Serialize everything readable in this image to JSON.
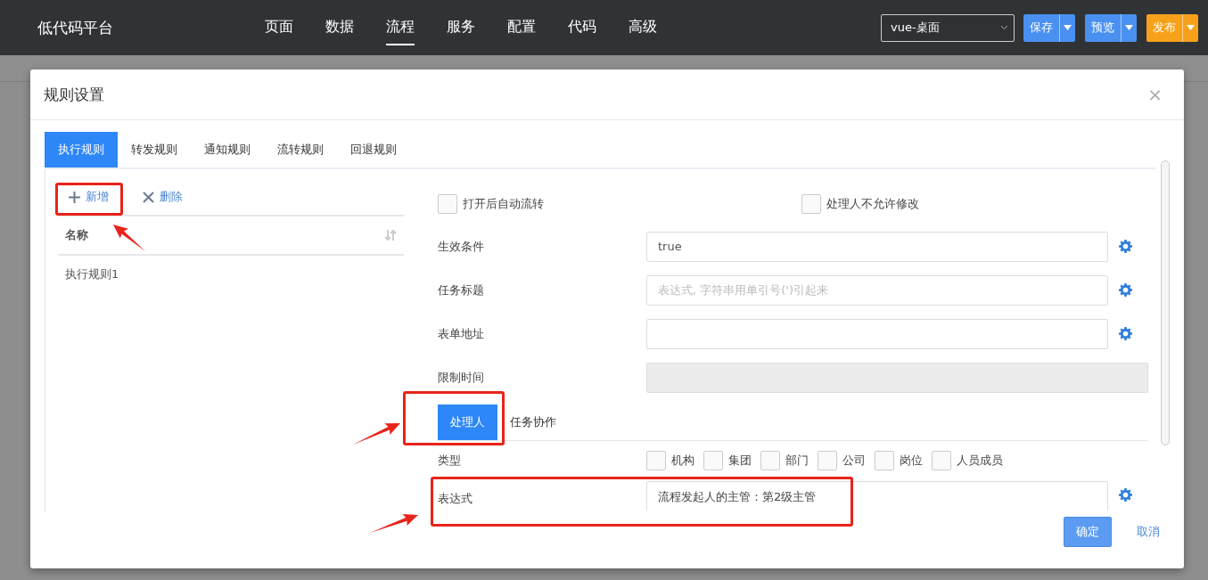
{
  "app": {
    "title": "低代码平台"
  },
  "nav": [
    {
      "label": "页面",
      "selected": false
    },
    {
      "label": "数据",
      "selected": false
    },
    {
      "label": "流程",
      "selected": true
    },
    {
      "label": "服务",
      "selected": false
    },
    {
      "label": "配置",
      "selected": false
    },
    {
      "label": "代码",
      "selected": false
    },
    {
      "label": "高级",
      "selected": false
    }
  ],
  "env_select": {
    "value": "vue-桌面"
  },
  "actions": [
    {
      "label": "保存",
      "kind": "primary"
    },
    {
      "label": "预览",
      "kind": "primary"
    },
    {
      "label": "发布",
      "kind": "warning"
    }
  ],
  "dialog": {
    "title": "规则设置",
    "close": "×",
    "tabs": [
      {
        "label": "执行规则",
        "selected": true
      },
      {
        "label": "转发规则",
        "selected": false
      },
      {
        "label": "通知规则",
        "selected": false
      },
      {
        "label": "流转规则",
        "selected": false
      },
      {
        "label": "回退规则",
        "selected": false
      }
    ],
    "rule_toolbar": [
      {
        "label": "新增",
        "kind": "add"
      },
      {
        "label": "删除",
        "kind": "delete"
      }
    ],
    "rule_table": {
      "columns": [
        "名称"
      ],
      "rows": [
        "执行规则1"
      ]
    },
    "options": [
      {
        "label": "打开后自动流转",
        "checked": false
      },
      {
        "label": "处理人不允许修改",
        "checked": false
      }
    ],
    "fields": [
      {
        "label": "生效条件",
        "kind": "input",
        "value": "true"
      },
      {
        "label": "任务标题",
        "kind": "input",
        "placeholder": "表达式, 字符串用单引号(')引起来"
      },
      {
        "label": "表单地址",
        "kind": "input"
      },
      {
        "label": "限制时间",
        "kind": "disabled"
      }
    ],
    "sub_tabs": [
      {
        "label": "处理人",
        "selected": true
      },
      {
        "label": "任务协作",
        "selected": false
      }
    ],
    "type_field": {
      "label": "类型",
      "options": [
        {
          "label": "机构",
          "checked": false
        },
        {
          "label": "集团",
          "checked": false
        },
        {
          "label": "部门",
          "checked": false
        },
        {
          "label": "公司",
          "checked": false
        },
        {
          "label": "岗位",
          "checked": false
        },
        {
          "label": "人员成员",
          "checked": false
        }
      ]
    },
    "expression": {
      "label": "表达式",
      "value": "流程发起人的主管：第2级主管"
    },
    "buttons": [
      {
        "label": "确定",
        "kind": "primary"
      },
      {
        "label": "取消",
        "kind": "link"
      }
    ]
  }
}
